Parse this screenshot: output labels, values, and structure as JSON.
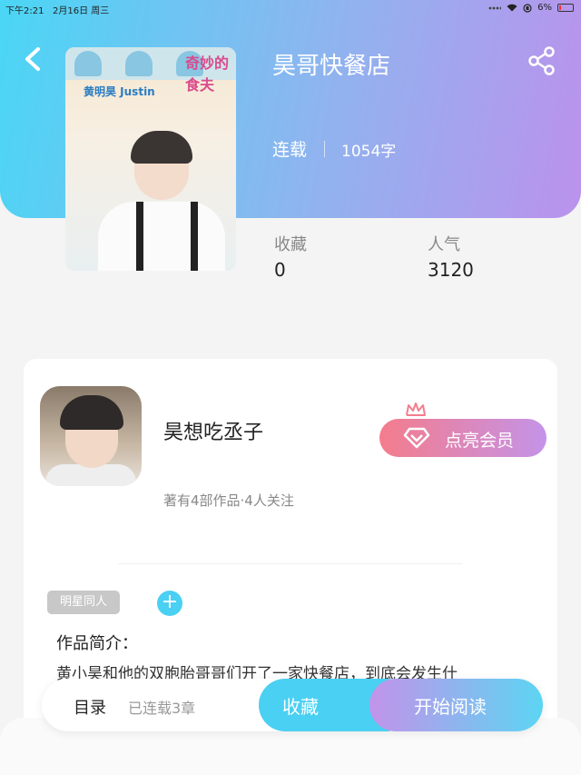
{
  "status_bar": {
    "time": "下午2:21",
    "date": "2月16日 周三",
    "battery": "6%"
  },
  "book": {
    "title": "昊哥快餐店",
    "status": "连载",
    "word_count": "1054字",
    "cover": {
      "logo_text": "奇妙的食夫",
      "name_tag": "黄明昊 Justin"
    },
    "stats": [
      {
        "label": "收藏",
        "value": "0"
      },
      {
        "label": "人气",
        "value": "3120"
      }
    ]
  },
  "author": {
    "name": "昊想吃丞子",
    "meta": "著有4部作品·4人关注",
    "vip_button": "点亮会员"
  },
  "tags": [
    "明星同人"
  ],
  "intro": {
    "label": "作品简介：",
    "text": "黄小昊和他的双胞胎哥哥们开了一家快餐店，到底会发生什"
  },
  "bottom_bar": {
    "toc_label": "目录",
    "toc_count": "已连载3章",
    "favorite_button": "收藏",
    "read_button": "开始阅读"
  },
  "colors": {
    "accent_cyan": "#4ad0f2",
    "accent_purple": "#bb92ec",
    "vip_pink": "#f47c8c"
  }
}
